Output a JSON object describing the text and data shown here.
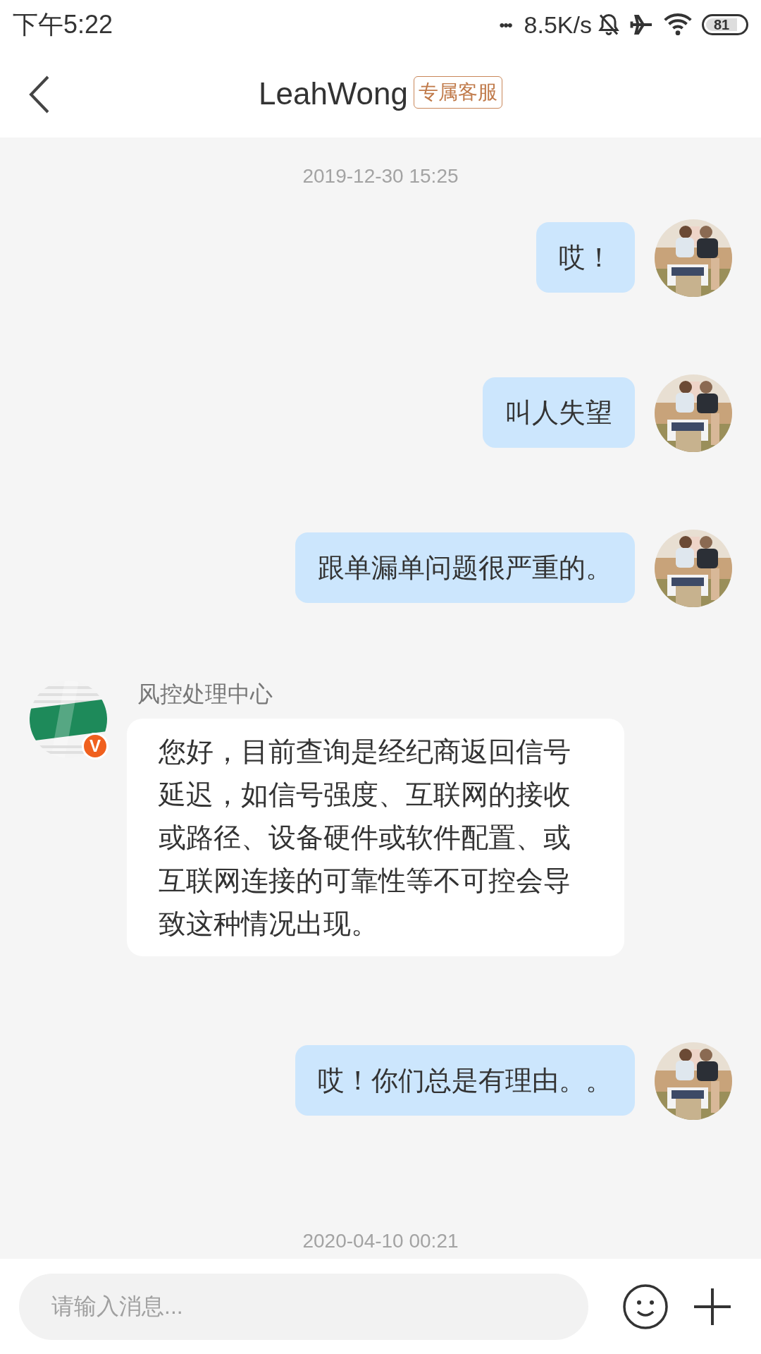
{
  "status_bar": {
    "time": "下午5:22",
    "dots": "•••",
    "speed": "8.5K/s",
    "battery": "81"
  },
  "header": {
    "title": "LeahWong",
    "tag": "专属客服"
  },
  "messages": [
    {
      "kind": "time",
      "text": "2019-12-30 15:25"
    },
    {
      "kind": "outgoing",
      "text": "哎！"
    },
    {
      "kind": "outgoing",
      "text": "叫人失望"
    },
    {
      "kind": "outgoing",
      "text": "跟单漏单问题很严重的。"
    },
    {
      "kind": "incoming",
      "sender": "风控处理中心",
      "badge": "V",
      "text": "您好，目前查询是经纪商返回信号延迟，如信号强度、互联网的接收或路径、设备硬件或软件配置、或互联网连接的可靠性等不可控会导致这种情况出现。"
    },
    {
      "kind": "outgoing",
      "text": "哎！你们总是有理由。。"
    },
    {
      "kind": "time",
      "text": "2020-04-10 00:21"
    }
  ],
  "input": {
    "placeholder": "请输入消息..."
  }
}
